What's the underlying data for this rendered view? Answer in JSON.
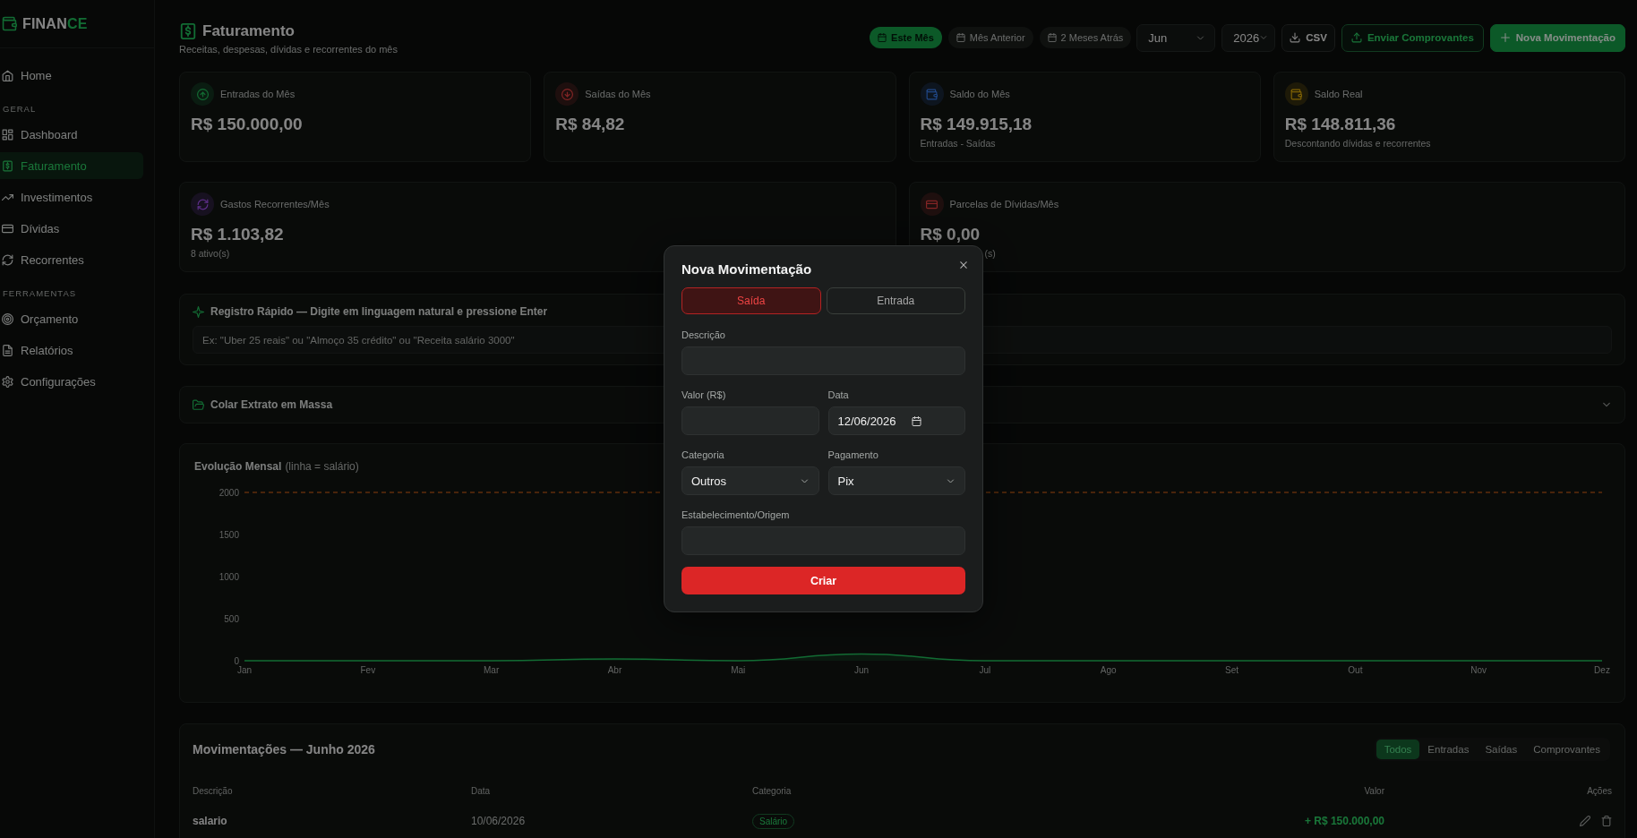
{
  "sidebar": {
    "logo": {
      "main": "FINAN",
      "accent": "CE"
    },
    "sections": [
      {
        "items": [
          {
            "label": "Home",
            "selected": false
          }
        ]
      },
      {
        "heading": "GERAL",
        "items": [
          {
            "label": "Dashboard",
            "selected": false
          },
          {
            "label": "Faturamento",
            "selected": true
          },
          {
            "label": "Investimentos",
            "selected": false
          },
          {
            "label": "Dívidas",
            "selected": false
          },
          {
            "label": "Recorrentes",
            "selected": false
          }
        ]
      },
      {
        "heading": "FERRAMENTAS",
        "items": [
          {
            "label": "Orçamento",
            "selected": false
          },
          {
            "label": "Relatórios",
            "selected": false
          },
          {
            "label": "Configurações",
            "selected": false
          }
        ]
      }
    ]
  },
  "header": {
    "title": "Faturamento",
    "subtitle": "Receitas, despesas, dívidas e recorrentes do mês",
    "periods": [
      {
        "label": "Este Mês",
        "selected": true
      },
      {
        "label": "Mês Anterior",
        "selected": false
      },
      {
        "label": "2 Meses Atrás",
        "selected": false
      }
    ],
    "month_select": {
      "value": "Jun"
    },
    "year_select": {
      "value": "2026"
    },
    "actions": [
      {
        "kind": "outline",
        "label": "CSV"
      },
      {
        "kind": "accent_outline",
        "label": "Enviar Comprovantes"
      },
      {
        "kind": "primary",
        "label": "Nova Movimentação"
      }
    ]
  },
  "stats_row_1": [
    {
      "label": "Entradas do Mês",
      "value": "R$ 150.000,00"
    },
    {
      "label": "Saídas do Mês",
      "value": "R$ 84,82"
    },
    {
      "label": "Saldo do Mês",
      "value": "R$ 149.915,18",
      "note": "Entradas - Saídas"
    },
    {
      "label": "Saldo Real",
      "value": "R$ 148.811,36",
      "note": "Descontando dívidas e recorrentes"
    }
  ],
  "stats_row_2": [
    {
      "label": "Gastos Recorrentes/Mês",
      "value": "R$ 1.103,82",
      "note": "8 ativo(s)"
    },
    {
      "label": "Parcelas de Dívidas/Mês",
      "value": "R$ 0,00",
      "note": "(s)",
      "note_partly_covered": true
    }
  ],
  "quick_entry": {
    "title": "Registro Rápido — Digite em linguagem natural e pressione Enter",
    "placeholder": "Ex: \"Uber 25 reais\" ou \"Almoço 35 crédito\" ou \"Receita salário 3000\""
  },
  "bulk_paste": {
    "title": "Colar Extrato em Massa",
    "expanded": false
  },
  "chart": {
    "note": "(linha = salário)",
    "chart_data": {
      "type": "area",
      "title": "Evolução Mensal",
      "categories": [
        "Jan",
        "Fev",
        "Mar",
        "Abr",
        "Mai",
        "Jun",
        "Jul",
        "Ago",
        "Set",
        "Out",
        "Nov",
        "Dez"
      ],
      "series": [
        {
          "color": "#22c55e",
          "values": [
            0,
            0,
            0,
            20,
            0,
            80,
            0,
            0,
            0,
            0,
            0,
            0
          ]
        }
      ],
      "ylim": [
        0,
        2000
      ],
      "yticks": [
        0,
        500,
        1000,
        1500,
        2000
      ],
      "ref_lines": [
        {
          "axis": "y",
          "value": 2000,
          "color": "#f97316"
        }
      ]
    }
  },
  "transactions": {
    "title": "Movimentações — Junho 2026",
    "filters": [
      {
        "label": "Todos",
        "selected": true
      },
      {
        "label": "Entradas",
        "selected": false
      },
      {
        "label": "Saídas",
        "selected": false
      },
      {
        "label": "Comprovantes",
        "selected": false
      }
    ],
    "columns": [
      "Descrição",
      "Data",
      "Categoria",
      "Valor",
      "Ações"
    ],
    "rows": [
      {
        "kind": "income",
        "description": "salario",
        "date": "10/06/2026",
        "category": "Salário",
        "value": "+ R$ 150.000,00"
      }
    ]
  },
  "modal": {
    "title": "Nova Movimentação",
    "type_toggle": [
      {
        "kind": "expense",
        "label": "Saída",
        "selected": true
      },
      {
        "kind": "income",
        "label": "Entrada",
        "selected": false
      }
    ],
    "field_rows": [
      {
        "fields": [
          {
            "kind": "text",
            "label": "Descrição"
          }
        ]
      },
      {
        "fields": [
          {
            "kind": "text",
            "label": "Valor (R$)"
          },
          {
            "kind": "date",
            "label": "Data",
            "value": "12/06/2026"
          }
        ]
      },
      {
        "fields": [
          {
            "kind": "select",
            "label": "Categoria",
            "value": "Outros"
          },
          {
            "kind": "select",
            "label": "Pagamento",
            "value": "Pix"
          }
        ]
      },
      {
        "fields": [
          {
            "kind": "text",
            "label": "Estabelecimento/Origem"
          }
        ]
      }
    ],
    "submit": "Criar"
  }
}
